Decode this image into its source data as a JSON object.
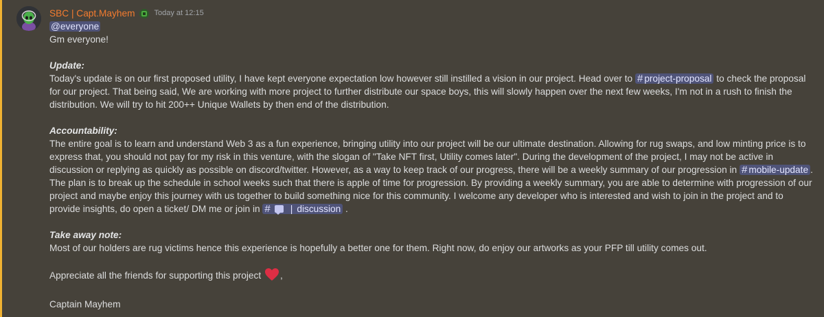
{
  "author": {
    "name": "SBC | Capt.Mayhem",
    "timestamp": "Today at 12:15"
  },
  "message": {
    "mention": "@everyone",
    "greeting": "Gm everyone!",
    "update_heading": "Update:",
    "update_p1": "Today's update is on our first proposed utility, I have kept everyone expectation low however still instilled a vision in our project. Head over to",
    "update_channel": "project-proposal",
    "update_p2": "to check the proposal for our project. That being said, We are working with more project to further distribute our space boys, this will slowly happen over the next few weeks, I'm not in a rush to finish the distribution. We will try to hit 200++ Unique Wallets by then end of the distribution.",
    "accountability_heading": "Accountability:",
    "accountability_p1": "The entire goal is to learn and understand Web 3 as a  fun experience, bringing utility into our project will be our ultimate destination. Allowing for rug swaps, and low minting price is to express that, you should not pay for my risk in this venture, with the slogan of \"Take NFT first, Utility comes later\". During the development of the project, I may not be active in discussion or replying as quickly as possible on discord/twitter. However, as a way to keep track of our progress, there will be a weekly summary of our progression in",
    "accountability_channel": "mobile-update",
    "accountability_p2": ". The plan is to break up the schedule in school weeks such that there is apple of time for progression. By providing a weekly summary, you are able to determine with progression of our project and maybe enjoy this journey with us together to build something nice for this community. I welcome any developer who is interested and wish to join in the project and to provide insights, do open a ticket/ DM me or join in",
    "discussion_channel_sep": "|",
    "discussion_channel": "discussion",
    "accountability_end": ".",
    "takeaway_heading": "Take away note:",
    "takeaway_p": "Most of our holders are rug victims hence this experience is hopefully a better one for them. Right now, do enjoy our artworks as your PFP till utility comes out.",
    "appreciate": "Appreciate all the friends for supporting this project",
    "appreciate_end": ",",
    "signature": "Captain Mayhem"
  },
  "icons": {
    "avatar": "alien-avatar",
    "role": "role-icon",
    "heart": "heart-emoji",
    "chat": "speech-balloon-emoji"
  },
  "colors": {
    "background": "#46423a",
    "accent_border": "#f0b232",
    "username": "#f47c2f",
    "mention_bg": "#4f5378"
  }
}
